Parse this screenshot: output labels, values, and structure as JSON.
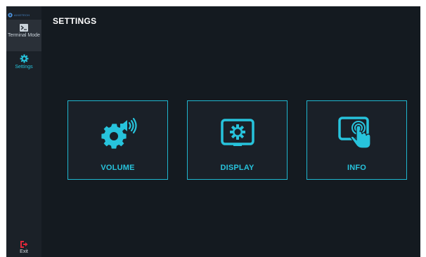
{
  "brand": {
    "logo_text": "AXIOTECH",
    "icon": "brand-logo-icon"
  },
  "sidebar": {
    "items": [
      {
        "label": "Terminal Mode",
        "icon": "terminal-icon",
        "active": false
      },
      {
        "label": "Settings",
        "icon": "gear-icon",
        "active": true
      }
    ],
    "exit": {
      "label": "Exit",
      "icon": "exit-icon"
    }
  },
  "header": {
    "title": "SETTINGS"
  },
  "tiles": [
    {
      "label": "VOLUME",
      "icon": "volume-gear-icon"
    },
    {
      "label": "DISPLAY",
      "icon": "display-settings-icon"
    },
    {
      "label": "INFO",
      "icon": "touch-info-icon"
    }
  ],
  "colors": {
    "accent": "#27c3dc",
    "background": "#141a20",
    "sidebar": "#1b2128",
    "tile_border": "#1fb6cf",
    "exit": "#e0283a"
  }
}
